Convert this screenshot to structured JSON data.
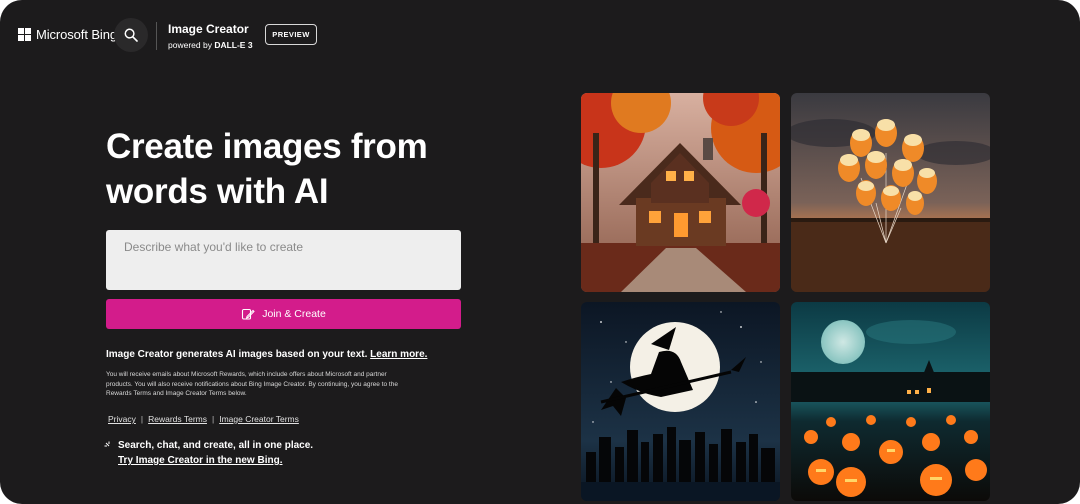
{
  "header": {
    "brand": "Microsoft Bing",
    "product_title": "Image Creator",
    "product_sub_prefix": "powered by ",
    "product_sub_model": "DALL-E 3",
    "preview_badge": "PREVIEW"
  },
  "hero": {
    "title_line1": "Create images from",
    "title_line2": "words with AI"
  },
  "prompt": {
    "placeholder": "Describe what you'd like to create"
  },
  "join_button": "Join & Create",
  "info": {
    "text": "Image Creator generates AI images based on your text. ",
    "link": "Learn more."
  },
  "fine_print": "You will receive emails about Microsoft Rewards, which include offers about Microsoft and partner products. You will also receive notifications about Bing Image Creator. By continuing, you agree to the Rewards Terms and Image Creator Terms below.",
  "terms": {
    "privacy": "Privacy",
    "rewards": "Rewards Terms",
    "image_creator": "Image Creator Terms",
    "separator": "|"
  },
  "promo": {
    "text": "Search, chat, and create, all in one place.",
    "link": "Try Image Creator in the new Bing."
  },
  "gallery": [
    {
      "subject": "autumn-cabin"
    },
    {
      "subject": "candy-corn-balloons"
    },
    {
      "subject": "witch-moon-city"
    },
    {
      "subject": "pumpkin-field-moon"
    }
  ],
  "colors": {
    "background": "#1c1b1c",
    "accent": "#d31c8b",
    "input": "#eeeeee"
  }
}
